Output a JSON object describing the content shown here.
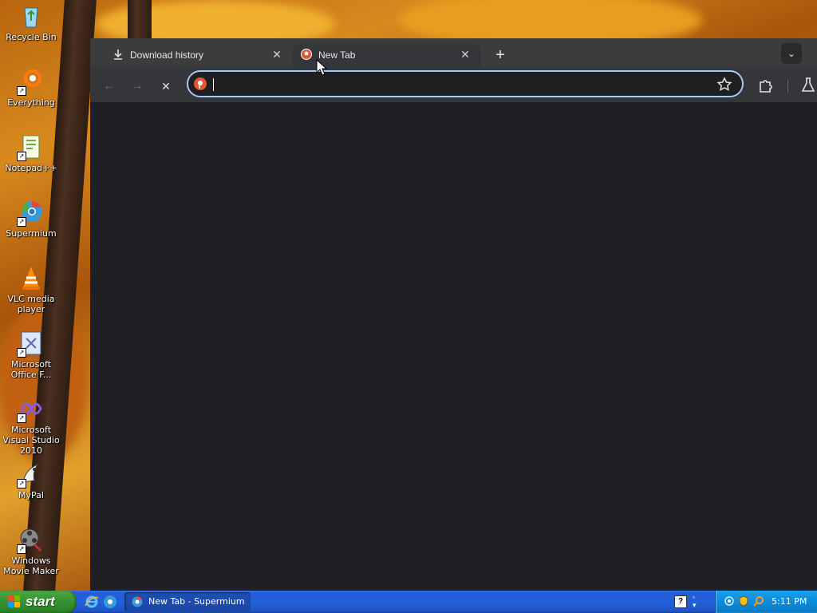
{
  "desktop": {
    "icons": [
      {
        "label": "Recycle Bin",
        "icon": "recycle-bin-icon"
      },
      {
        "label": "Everything",
        "icon": "everything-search-icon"
      },
      {
        "label": "Notepad++",
        "icon": "notepad-plus-plus-icon"
      },
      {
        "label": "Supermium",
        "icon": "supermium-icon"
      },
      {
        "label": "VLC media player",
        "icon": "vlc-icon"
      },
      {
        "label": "Microsoft Office F...",
        "icon": "office-file-icon"
      },
      {
        "label": "Microsoft Visual Studio 2010",
        "icon": "visual-studio-icon"
      },
      {
        "label": "MyPal",
        "icon": "mypal-icon"
      },
      {
        "label": "Windows Movie Maker",
        "icon": "movie-maker-icon"
      }
    ]
  },
  "browser": {
    "tabs": [
      {
        "title": "Download history",
        "icon": "download-icon",
        "active": false
      },
      {
        "title": "New Tab",
        "icon": "duckduckgo-icon",
        "active": true
      }
    ],
    "close_glyph": "✕",
    "new_tab_glyph": "+",
    "tab_search_glyph": "⌄",
    "toolbar": {
      "back_glyph": "←",
      "forward_glyph": "→",
      "stop_glyph": "✕",
      "address_value": "",
      "address_icon": "duckduckgo-icon",
      "star_glyph": "☆"
    },
    "colors": {
      "frame": "#3c3c3c",
      "toolbar": "#35363a",
      "content": "#1f2024",
      "focus_ring": "#a8c7fa"
    }
  },
  "taskbar": {
    "start_label": "start",
    "quicklaunch": [
      "internet-explorer-icon",
      "supermium-icon"
    ],
    "tasks": [
      {
        "label": "New Tab - Supermium",
        "icon": "supermium-icon"
      }
    ],
    "tray": {
      "help_glyph": "?",
      "icons": [
        "network-icon",
        "security-shield-icon",
        "search-icon"
      ],
      "clock": "5:11 PM"
    }
  }
}
